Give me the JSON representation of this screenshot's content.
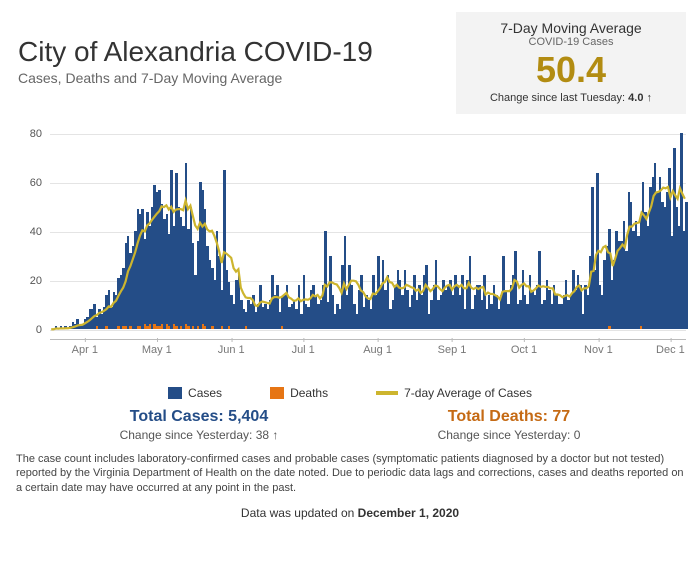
{
  "header": {
    "title": "City of Alexandria COVID-19",
    "subtitle": "Cases, Deaths and 7-Day Moving Average"
  },
  "avg_box": {
    "title": "7-Day Moving Average",
    "sub": "COVID-19 Cases",
    "value": "50.4",
    "change_label": "Change since last Tuesday:",
    "change_value": "4.0"
  },
  "legend": {
    "cases": "Cases",
    "deaths": "Deaths",
    "avg": "7-day Average of Cases"
  },
  "totals": {
    "cases_label": "Total Cases:",
    "cases_value": "5,404",
    "cases_change_label": "Change since Yesterday:",
    "cases_change": "38",
    "deaths_label": "Total Deaths:",
    "deaths_value": "77",
    "deaths_change_label": "Change since Yesterday:",
    "deaths_change": "0"
  },
  "footnote": "The case count includes laboratory-confirmed cases and probable cases (symptomatic patients diagnosed by a doctor but not tested) reported by the Virginia Department of Health on the date noted. Due to periodic data lags and corrections, cases and deaths reported on a certain date may have occurred at any point in the past.",
  "updated_prefix": "Data was updated on ",
  "updated_date": "December 1, 2020",
  "colors": {
    "cases": "#244d87",
    "deaths": "#e67514",
    "avg": "#cdb52e"
  },
  "chart_data": {
    "type": "bar+line",
    "ylabel": "",
    "xlabel": "",
    "ylim": [
      -4,
      82
    ],
    "y_ticks": [
      0,
      20,
      40,
      60,
      80
    ],
    "x_ticks": [
      "Apr 1",
      "May 1",
      "Jun 1",
      "Jul 1",
      "Aug 1",
      "Sep 1",
      "Oct 1",
      "Nov 1",
      "Dec 1"
    ],
    "x_tick_indices": [
      14,
      44,
      75,
      105,
      136,
      167,
      197,
      228,
      258
    ],
    "start_date": "2020-03-18",
    "series": [
      {
        "name": "Cases",
        "type": "bar",
        "color": "#244d87",
        "values": [
          0,
          0,
          1,
          0,
          1,
          0,
          1,
          0,
          1,
          3,
          2,
          4,
          1,
          2,
          4,
          5,
          8,
          8,
          10,
          4,
          8,
          6,
          9,
          13,
          16,
          9,
          15,
          14,
          20,
          22,
          24,
          34,
          38,
          30,
          34,
          40,
          48,
          46,
          49,
          35,
          47,
          40,
          50,
          57,
          55,
          56,
          49,
          45,
          45,
          38,
          65,
          40,
          63,
          50,
          45,
          42,
          66,
          40,
          50,
          34,
          22,
          35,
          60,
          55,
          48,
          34,
          28,
          24,
          20,
          40,
          30,
          15,
          65,
          24,
          18,
          14,
          10,
          20,
          22,
          12,
          8,
          6,
          12,
          10,
          14,
          7,
          10,
          18,
          9,
          10,
          8,
          12,
          22,
          14,
          18,
          7,
          12,
          14,
          18,
          9,
          10,
          12,
          8,
          18,
          6,
          22,
          10,
          9,
          16,
          18,
          14,
          10,
          12,
          18,
          40,
          11,
          30,
          14,
          6,
          10,
          8,
          26,
          38,
          14,
          26,
          18,
          10,
          6,
          16,
          22,
          9,
          14,
          12,
          8,
          22,
          14,
          30,
          18,
          28,
          16,
          22,
          8,
          12,
          18,
          24,
          20,
          14,
          24,
          16,
          9,
          14,
          22,
          12,
          18,
          14,
          22,
          26,
          6,
          12,
          18,
          28,
          12,
          14,
          20,
          16,
          18,
          20,
          14,
          22,
          18,
          14,
          22,
          8,
          20,
          30,
          8,
          14,
          18,
          18,
          12,
          22,
          8,
          14,
          10,
          18,
          14,
          8,
          14,
          30,
          16,
          10,
          18,
          22,
          32,
          10,
          12,
          24,
          14,
          10,
          22,
          16,
          14,
          18,
          32,
          10,
          12,
          20,
          16,
          10,
          18,
          14,
          10,
          10,
          14,
          20,
          12,
          14,
          24,
          16,
          22,
          18,
          6,
          18,
          14,
          30,
          58,
          24,
          64,
          18,
          14,
          28,
          34,
          40,
          20,
          28,
          40,
          36,
          36,
          44,
          32,
          56,
          52,
          40,
          44,
          38,
          46,
          60,
          48,
          42,
          58,
          62,
          68,
          56,
          62,
          52,
          50,
          56,
          66,
          38,
          74,
          50,
          42,
          80,
          40,
          52
        ]
      },
      {
        "name": "Deaths",
        "type": "bar",
        "color": "#e67514",
        "values": [
          0,
          0,
          0,
          0,
          0,
          0,
          0,
          0,
          0,
          0,
          0,
          0,
          0,
          0,
          0,
          0,
          0,
          0,
          0,
          1,
          0,
          0,
          0,
          1,
          0,
          0,
          0,
          0,
          1,
          0,
          1,
          1,
          0,
          1,
          0,
          0,
          1,
          1,
          0,
          2,
          1,
          2,
          0,
          2,
          1,
          1,
          2,
          0,
          2,
          1,
          0,
          2,
          1,
          0,
          1,
          0,
          2,
          1,
          0,
          1,
          0,
          1,
          0,
          2,
          1,
          0,
          0,
          1,
          0,
          0,
          0,
          1,
          0,
          0,
          1,
          0,
          0,
          0,
          0,
          0,
          0,
          1,
          0,
          0,
          0,
          0,
          0,
          0,
          0,
          0,
          0,
          0,
          0,
          0,
          0,
          0,
          1,
          0,
          0,
          0,
          0,
          0,
          0,
          0,
          0,
          0,
          0,
          0,
          0,
          0,
          0,
          0,
          0,
          0,
          0,
          0,
          0,
          0,
          0,
          0,
          0,
          0,
          0,
          0,
          0,
          0,
          0,
          0,
          0,
          0,
          0,
          0,
          0,
          0,
          0,
          0,
          0,
          0,
          0,
          0,
          0,
          0,
          0,
          0,
          0,
          0,
          0,
          0,
          0,
          0,
          0,
          0,
          0,
          0,
          0,
          0,
          0,
          0,
          0,
          0,
          0,
          0,
          0,
          0,
          0,
          0,
          0,
          0,
          0,
          0,
          0,
          0,
          0,
          0,
          0,
          0,
          0,
          0,
          0,
          0,
          0,
          0,
          0,
          0,
          0,
          0,
          0,
          0,
          0,
          0,
          0,
          0,
          0,
          0,
          0,
          0,
          0,
          0,
          0,
          0,
          0,
          0,
          0,
          0,
          0,
          0,
          0,
          0,
          0,
          0,
          0,
          0,
          0,
          0,
          0,
          0,
          0,
          0,
          0,
          0,
          0,
          0,
          0,
          0,
          0,
          0,
          0,
          0,
          0,
          0,
          0,
          0,
          1,
          0,
          0,
          0,
          0,
          0,
          0,
          0,
          0,
          0,
          0,
          0,
          0,
          1,
          0,
          0,
          0,
          0,
          0,
          0,
          0,
          0,
          0,
          0,
          0,
          0,
          0,
          0,
          0,
          0,
          0,
          0,
          0
        ]
      },
      {
        "name": "7-day Average of Cases",
        "type": "line",
        "color": "#cdb52e"
      }
    ]
  }
}
